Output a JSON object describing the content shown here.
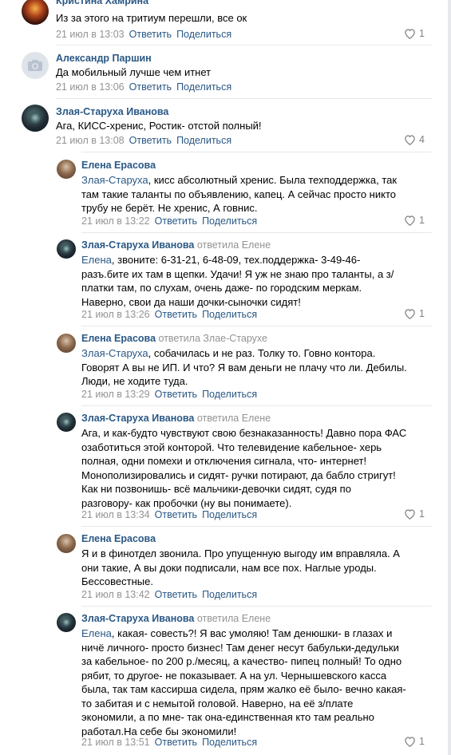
{
  "colors": {
    "link": "#2a5885",
    "muted": "#939393",
    "separator": "#e7e8ec"
  },
  "reply_link": "Ответить",
  "share_link": "Поделиться",
  "comments": [
    {
      "author": "Кристина Хамрина",
      "reply_to": "",
      "mention": "",
      "text": "Из за этого на тритиум перешли, все ок",
      "time": "21 июл в 13:03",
      "likes": "1",
      "avatar": "fire"
    },
    {
      "author": "Александр Паршин",
      "reply_to": "",
      "mention": "",
      "text": "Да мобильный лучше чем итнет",
      "time": "21 июл в 13:06",
      "likes": "",
      "avatar": "camera-icon"
    },
    {
      "author": "Злая-Старуха Иванова",
      "reply_to": "",
      "mention": "",
      "text": "Ага, КИСС-хренис, Ростик- отстой полный!",
      "time": "21 июл в 13:08",
      "likes": "4",
      "avatar": "dark"
    },
    {
      "author": "Елена Ерасова",
      "reply_to": "",
      "mention": "Злая-Старуха",
      "text": ", кисс абсолютный хренис. Была техподдержка, так\nтам такие таланты по объявлению, капец. А сейчас просто никто\nтрубу не берёт. Не хренис, А говнис.",
      "time": "21 июл в 13:22",
      "likes": "1",
      "avatar": "brown"
    },
    {
      "author": "Злая-Старуха Иванова",
      "reply_to": "ответила Елене",
      "mention": "Елена",
      "text": ", звоните: 6-31-21, 6-48-09, тех.поддержка- 3-49-46-\nразъ.бите их там в щепки. Удачи! Я уж не знаю про таланты, а з/\nплатки там, по слухам, очень даже- по городским меркам.\nНаверно, свои да наши дочки-сыночки сидят!",
      "time": "21 июл в 13:26",
      "likes": "1",
      "avatar": "dark"
    },
    {
      "author": "Елена Ерасова",
      "reply_to": "ответила Злае-Старухе",
      "mention": "Злая-Старуха",
      "text": ", собачилась и не раз. Толку то. Говно контора.\nГоворят А вы не ИП. И что? Я вам деньги не плачу что ли. Дебилы.\nЛюди, не ходите туда.",
      "time": "21 июл в 13:29",
      "likes": "",
      "avatar": "brown"
    },
    {
      "author": "Злая-Старуха Иванова",
      "reply_to": "ответила Елене",
      "mention": "",
      "text": "Ага, и как-будто чувствуют свою безнаказанность! Давно пора ФАС\nозаботиться этой конторой. Что телевидение кабельное- херь\nполная, одни помехи и отключения сигнала, что- интернет!\nМонополизировались и сидят- ручки потирают, да бабло стригут!\nКак ни позвонишь- всё мальчики-девочки сидят, судя по\nразговору- как пробочки (ну вы понимаете).",
      "time": "21 июл в 13:34",
      "likes": "1",
      "avatar": "dark"
    },
    {
      "author": "Елена Ерасова",
      "reply_to": "",
      "mention": "",
      "text": "Я и в финотдел звонила. Про упущенную выгоду им вправляла. А\nони такие, А вы доки подписали, нам все пох. Наглые уроды.\nБессовестные.",
      "time": "21 июл в 13:42",
      "likes": "",
      "avatar": "brown"
    },
    {
      "author": "Злая-Старуха Иванова",
      "reply_to": "ответила Елене",
      "mention": "Елена",
      "text": ", какая- совесть?! Я вас умоляю! Там денюшки- в глазах и\nничё личного- просто бизнес! Там денег несут бабульки-дедульки\nза кабельное- по 200 р./месяц, а качество- пипец полный! То одно\nрябит, то другое- не показывает. А на ул. Чернышевского касса\nбыла, так там кассирша сидела, прям жалко её было- вечно какая-\nто забитая и с немытой головой. Наверно, на её з/плате\nэкономили, а по мне- так она-единственная кто там реально\nработал.На себе бы экономили!",
      "time": "21 июл в 13:51",
      "likes": "1",
      "avatar": "dark"
    }
  ]
}
